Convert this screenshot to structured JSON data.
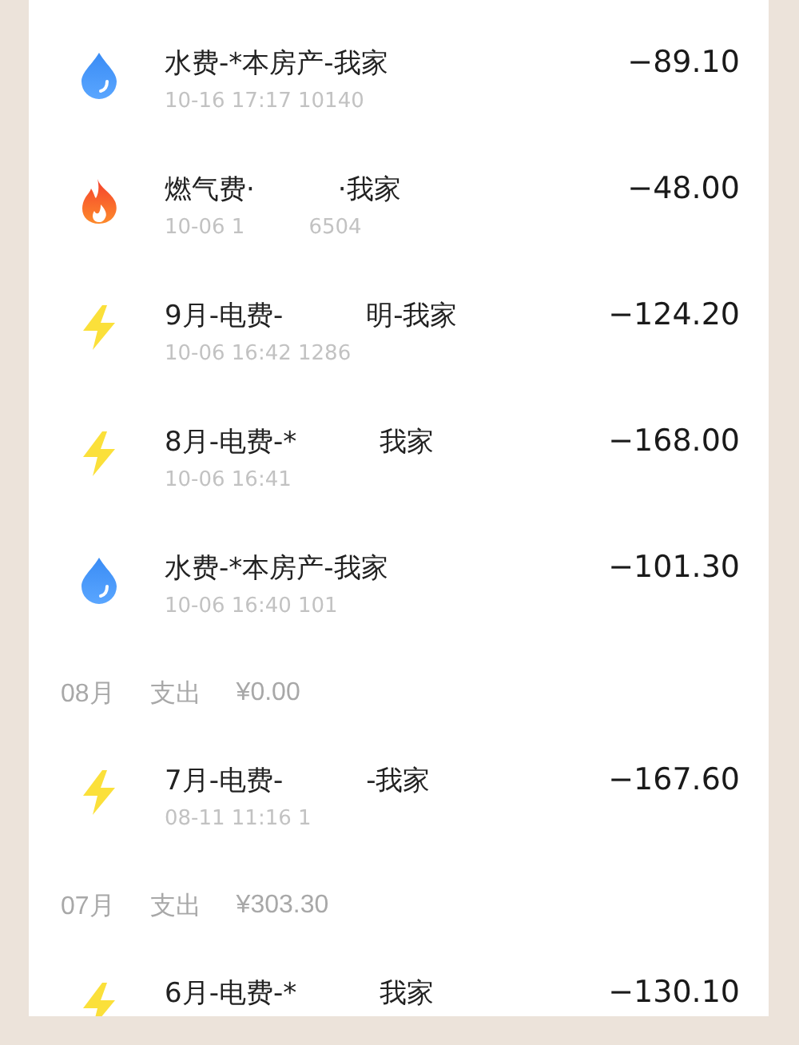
{
  "items": [
    {
      "kind": "water",
      "title": [
        "水费-*本房产-我家"
      ],
      "detail": [
        "10-16 17:17 10140"
      ],
      "amount": "−89.10"
    },
    {
      "kind": "gas",
      "title": [
        "燃气费·",
        "·我家"
      ],
      "detail": [
        "10-06 1",
        "6504"
      ],
      "amount": "−48.00"
    },
    {
      "kind": "power",
      "title": [
        "9月-电费-",
        "明-我家"
      ],
      "detail": [
        "10-06 16:42 1286"
      ],
      "amount": "−124.20"
    },
    {
      "kind": "power",
      "title": [
        "8月-电费-*",
        "我家"
      ],
      "detail": [
        "10-06 16:41"
      ],
      "amount": "−168.00"
    },
    {
      "kind": "water",
      "title": [
        "水费-*本房产-我家"
      ],
      "detail": [
        "10-06 16:40 101"
      ],
      "amount": "−101.30"
    },
    {
      "kind": "month",
      "month": "08月",
      "label": "支出",
      "total": "¥0.00"
    },
    {
      "kind": "power",
      "title": [
        "7月-电费-",
        "-我家"
      ],
      "detail": [
        "08-11 11:16 1"
      ],
      "amount": "−167.60"
    },
    {
      "kind": "month",
      "month": "07月",
      "label": "支出",
      "total": "¥303.30"
    },
    {
      "kind": "power",
      "title": [
        "6月-电费-*",
        "我家"
      ],
      "amount": "−130.10"
    }
  ]
}
